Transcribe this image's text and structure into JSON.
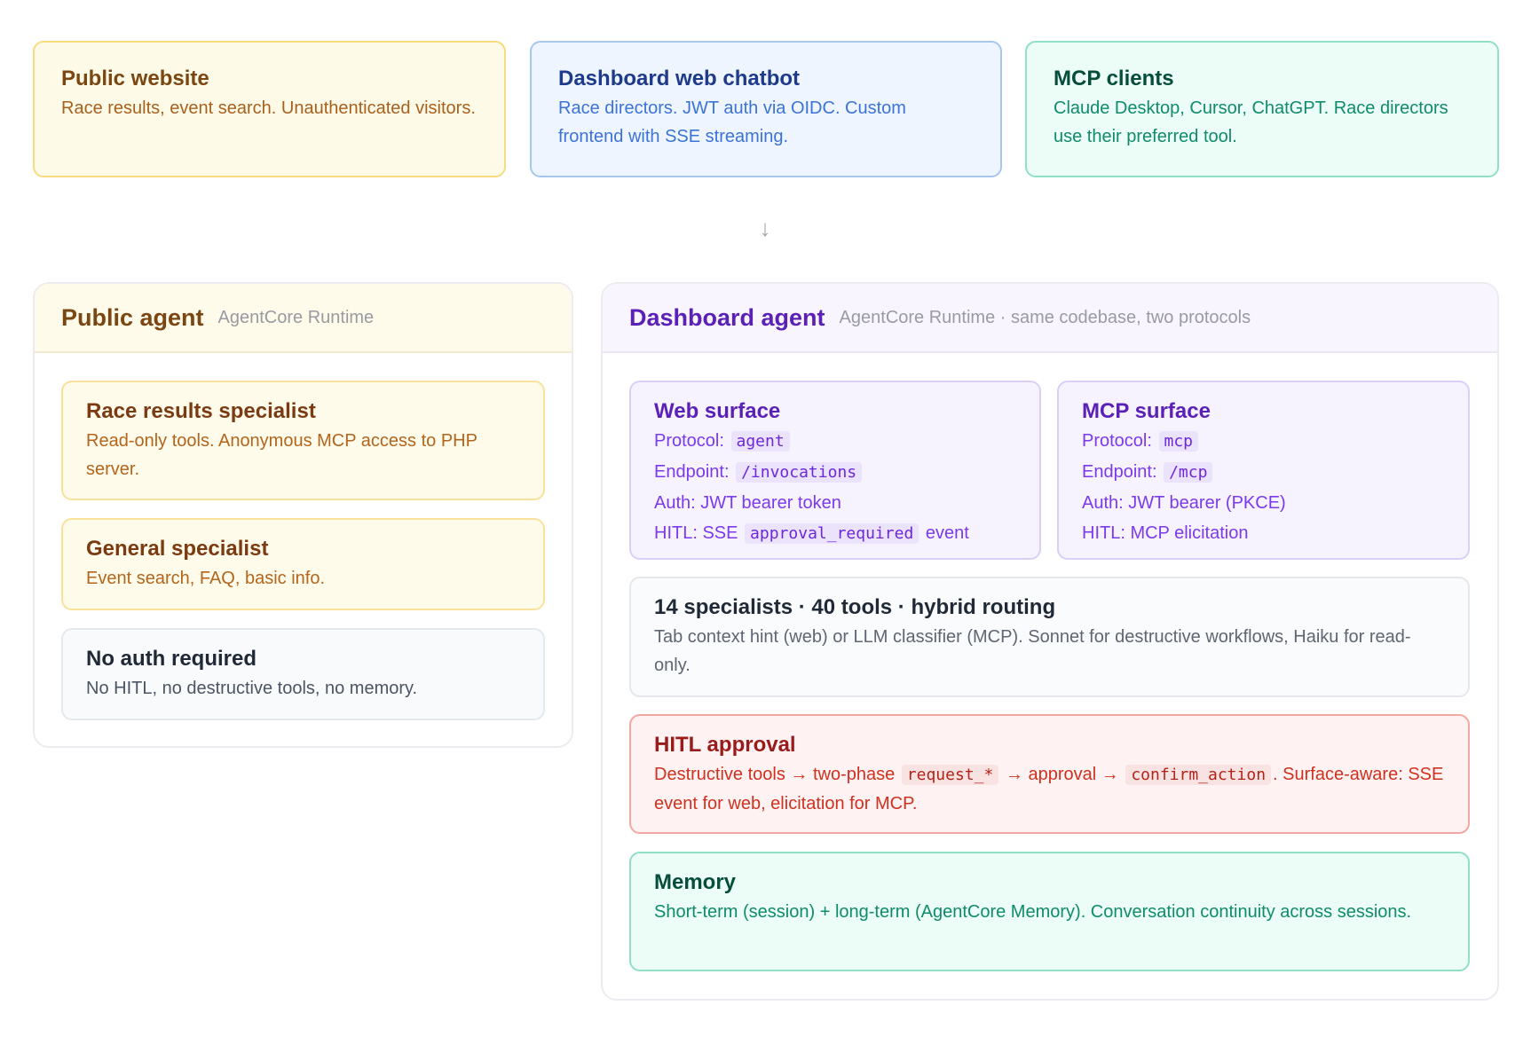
{
  "clients": {
    "public_website": {
      "title": "Public website",
      "desc": "Race results, event search. Unauthenticated visitors."
    },
    "dashboard_chatbot": {
      "title": "Dashboard web chatbot",
      "desc": "Race directors. JWT auth via OIDC. Custom frontend with SSE streaming."
    },
    "mcp_clients": {
      "title": "MCP clients",
      "desc": "Claude Desktop, Cursor, ChatGPT. Race directors use their preferred tool."
    }
  },
  "arrow": "↓",
  "public_agent": {
    "title": "Public agent",
    "subtitle": "AgentCore Runtime",
    "race": {
      "title": "Race results specialist",
      "desc": "Read-only tools. Anonymous MCP access to PHP server."
    },
    "general": {
      "title": "General specialist",
      "desc": "Event search, FAQ, basic info."
    },
    "noauth": {
      "title": "No auth required",
      "desc": "No HITL, no destructive tools, no memory."
    }
  },
  "dashboard_agent": {
    "title": "Dashboard agent",
    "subtitle": "AgentCore Runtime · same codebase, two protocols",
    "web": {
      "title": "Web surface",
      "protocol_label": "Protocol:",
      "protocol": "agent",
      "endpoint_label": "Endpoint:",
      "endpoint": "/invocations",
      "auth": "Auth: JWT bearer token",
      "hitl_label": "HITL: SSE",
      "hitl_code": "approval_required",
      "hitl_suffix": "event"
    },
    "mcp": {
      "title": "MCP surface",
      "protocol_label": "Protocol:",
      "protocol": "mcp",
      "endpoint_label": "Endpoint:",
      "endpoint": "/mcp",
      "auth": "Auth: JWT bearer (PKCE)",
      "hitl": "HITL: MCP elicitation"
    },
    "specialists": {
      "title": "14 specialists · 40 tools · hybrid routing",
      "desc": "Tab context hint (web) or LLM classifier (MCP). Sonnet for destructive workflows, Haiku for read-only."
    },
    "hitl": {
      "title": "HITL approval",
      "p1": "Destructive tools → two-phase",
      "c1": "request_*",
      "p2": "→ approval →",
      "c2": "confirm_action",
      "p3": ". Surface-aware: SSE event for web, elicitation for MCP."
    },
    "memory": {
      "title": "Memory",
      "desc": "Short-term (session) + long-term (AgentCore Memory). Conversation continuity across sessions."
    }
  }
}
